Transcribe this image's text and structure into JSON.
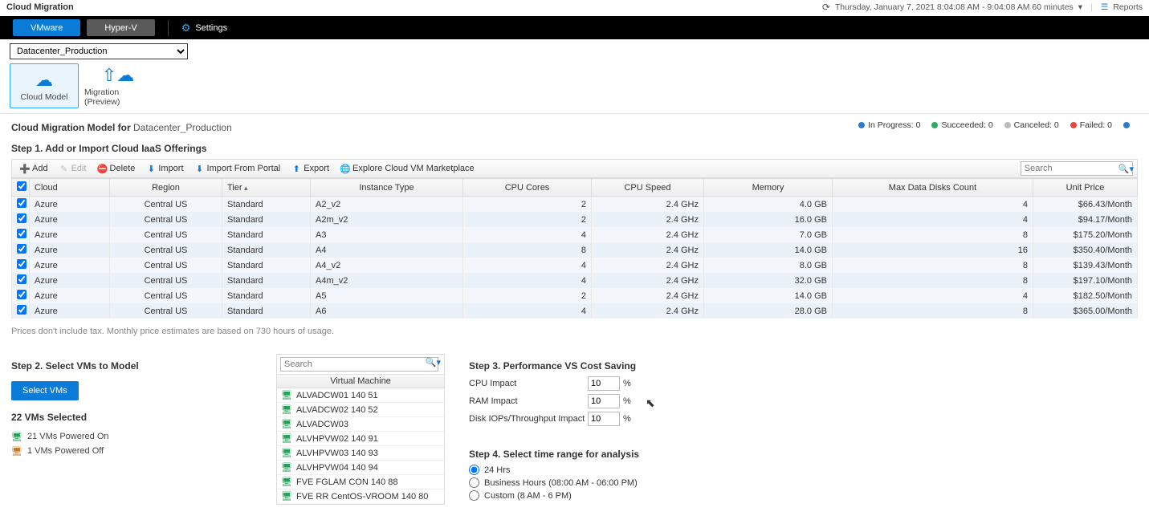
{
  "header": {
    "title": "Cloud Migration",
    "timerange": "Thursday, January 7, 2021 8:04:08 AM - 9:04:08 AM 60 minutes",
    "reports": "Reports"
  },
  "blackbar": {
    "tab_active": "VMware",
    "tab_inactive": "Hyper-V",
    "settings": "Settings"
  },
  "datacenter": {
    "selected": "Datacenter_Production"
  },
  "modes": {
    "cloud_model": "Cloud Model",
    "migration": "Migration (Preview)"
  },
  "model_for": {
    "label": "Cloud Migration Model for",
    "dc": "Datacenter_Production"
  },
  "statuses": {
    "in_progress": "In Progress: 0",
    "succeeded": "Succeeded: 0",
    "canceled": "Canceled: 0",
    "failed": "Failed: 0"
  },
  "step1": {
    "title": "Step 1. Add or Import Cloud IaaS Offerings",
    "toolbar": {
      "add": "Add",
      "edit": "Edit",
      "delete": "Delete",
      "import": "Import",
      "import_portal": "Import From Portal",
      "export": "Export",
      "explore": "Explore Cloud VM Marketplace",
      "search_ph": "Search"
    },
    "columns": {
      "cloud": "Cloud",
      "region": "Region",
      "tier": "Tier",
      "instance": "Instance Type",
      "cores": "CPU Cores",
      "speed": "CPU Speed",
      "memory": "Memory",
      "disks": "Max Data Disks Count",
      "price": "Unit Price"
    },
    "rows": [
      {
        "cloud": "Azure",
        "region": "Central US",
        "tier": "Standard",
        "instance": "A2_v2",
        "cores": "2",
        "speed": "2.4 GHz",
        "memory": "4.0 GB",
        "disks": "4",
        "price": "$66.43/Month"
      },
      {
        "cloud": "Azure",
        "region": "Central US",
        "tier": "Standard",
        "instance": "A2m_v2",
        "cores": "2",
        "speed": "2.4 GHz",
        "memory": "16.0 GB",
        "disks": "4",
        "price": "$94.17/Month"
      },
      {
        "cloud": "Azure",
        "region": "Central US",
        "tier": "Standard",
        "instance": "A3",
        "cores": "4",
        "speed": "2.4 GHz",
        "memory": "7.0 GB",
        "disks": "8",
        "price": "$175.20/Month"
      },
      {
        "cloud": "Azure",
        "region": "Central US",
        "tier": "Standard",
        "instance": "A4",
        "cores": "8",
        "speed": "2.4 GHz",
        "memory": "14.0 GB",
        "disks": "16",
        "price": "$350.40/Month"
      },
      {
        "cloud": "Azure",
        "region": "Central US",
        "tier": "Standard",
        "instance": "A4_v2",
        "cores": "4",
        "speed": "2.4 GHz",
        "memory": "8.0 GB",
        "disks": "8",
        "price": "$139.43/Month"
      },
      {
        "cloud": "Azure",
        "region": "Central US",
        "tier": "Standard",
        "instance": "A4m_v2",
        "cores": "4",
        "speed": "2.4 GHz",
        "memory": "32.0 GB",
        "disks": "8",
        "price": "$197.10/Month"
      },
      {
        "cloud": "Azure",
        "region": "Central US",
        "tier": "Standard",
        "instance": "A5",
        "cores": "2",
        "speed": "2.4 GHz",
        "memory": "14.0 GB",
        "disks": "4",
        "price": "$182.50/Month"
      },
      {
        "cloud": "Azure",
        "region": "Central US",
        "tier": "Standard",
        "instance": "A6",
        "cores": "4",
        "speed": "2.4 GHz",
        "memory": "28.0 GB",
        "disks": "8",
        "price": "$365.00/Month"
      }
    ],
    "note": "Prices don't include tax. Monthly price estimates are based on 730 hours of usage."
  },
  "step2": {
    "title": "Step 2. Select VMs to Model",
    "button": "Select VMs",
    "selected": "22 VMs Selected",
    "powered_on": "21 VMs Powered On",
    "powered_off": "1 VMs Powered Off",
    "panel": {
      "search_ph": "Search",
      "header": "Virtual Machine",
      "items": [
        "ALVADCW01 140 51",
        "ALVADCW02 140 52",
        "ALVADCW03",
        "ALVHPVW02 140 91",
        "ALVHPVW03 140 93",
        "ALVHPVW04 140 94",
        "FVE FGLAM CON 140 88",
        "FVE RR CentOS-VROOM 140 80"
      ]
    }
  },
  "step3": {
    "title": "Step 3. Performance VS Cost Saving",
    "params": {
      "cpu_label": "CPU Impact",
      "cpu_val": "10",
      "ram_label": "RAM Impact",
      "ram_val": "10",
      "disk_label": "Disk IOPs/Throughput Impact",
      "disk_val": "10",
      "pct": "%"
    }
  },
  "step4": {
    "title": "Step 4. Select time range for analysis",
    "opt1": "24 Hrs",
    "opt2": "Business Hours (08:00 AM - 06:00 PM)",
    "opt3": "Custom (8 AM - 6 PM)"
  }
}
